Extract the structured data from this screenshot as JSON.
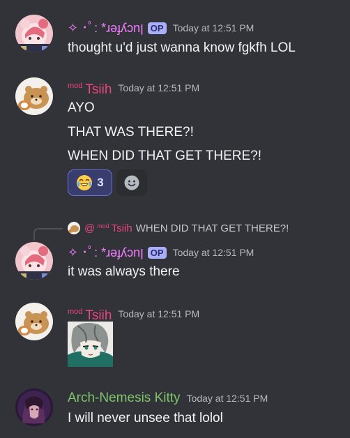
{
  "messages": [
    {
      "author": "✧ ･ﾟ: *ɹǝɟʎɔnן",
      "op_badge": "OP",
      "timestamp": "Today at 12:51 PM",
      "lines": [
        "thought u'd just wanna know fgkfh LOL"
      ]
    },
    {
      "author_prefix": "mod",
      "author": "Tsiih",
      "timestamp": "Today at 12:51 PM",
      "lines": [
        "AYO",
        "THAT WAS THERE?!",
        "WHEN DID THAT GET THERE?!"
      ],
      "reactions": [
        {
          "emoji": "😂",
          "count": "3",
          "icon": "joy-emoji-icon"
        },
        {
          "icon": "add-reaction-icon"
        }
      ]
    },
    {
      "reply": {
        "mention_at": "@",
        "mention_prefix": "mod",
        "mention_name": "Tsiih",
        "text": "WHEN DID THAT GET THERE?!"
      },
      "author": "✧ ･ﾟ: *ɹǝɟʎɔnן",
      "op_badge": "OP",
      "timestamp": "Today at 12:51 PM",
      "lines": [
        "it was always there"
      ]
    },
    {
      "author_prefix": "mod",
      "author": "Tsiih",
      "timestamp": "Today at 12:51 PM",
      "attachment": "sticker-anime-character-image"
    },
    {
      "author": "Arch-Nemesis Kitty",
      "timestamp": "Today at 12:51 PM",
      "lines": [
        "I will never unsee that lolol"
      ]
    }
  ],
  "colors": {
    "background": "#313338",
    "op_name": "#f47fff",
    "mod_name": "#e9467d",
    "kitty_name": "#7fc46a",
    "op_badge": "#a8b0f9",
    "reaction_active_border": "#6b72d8"
  }
}
